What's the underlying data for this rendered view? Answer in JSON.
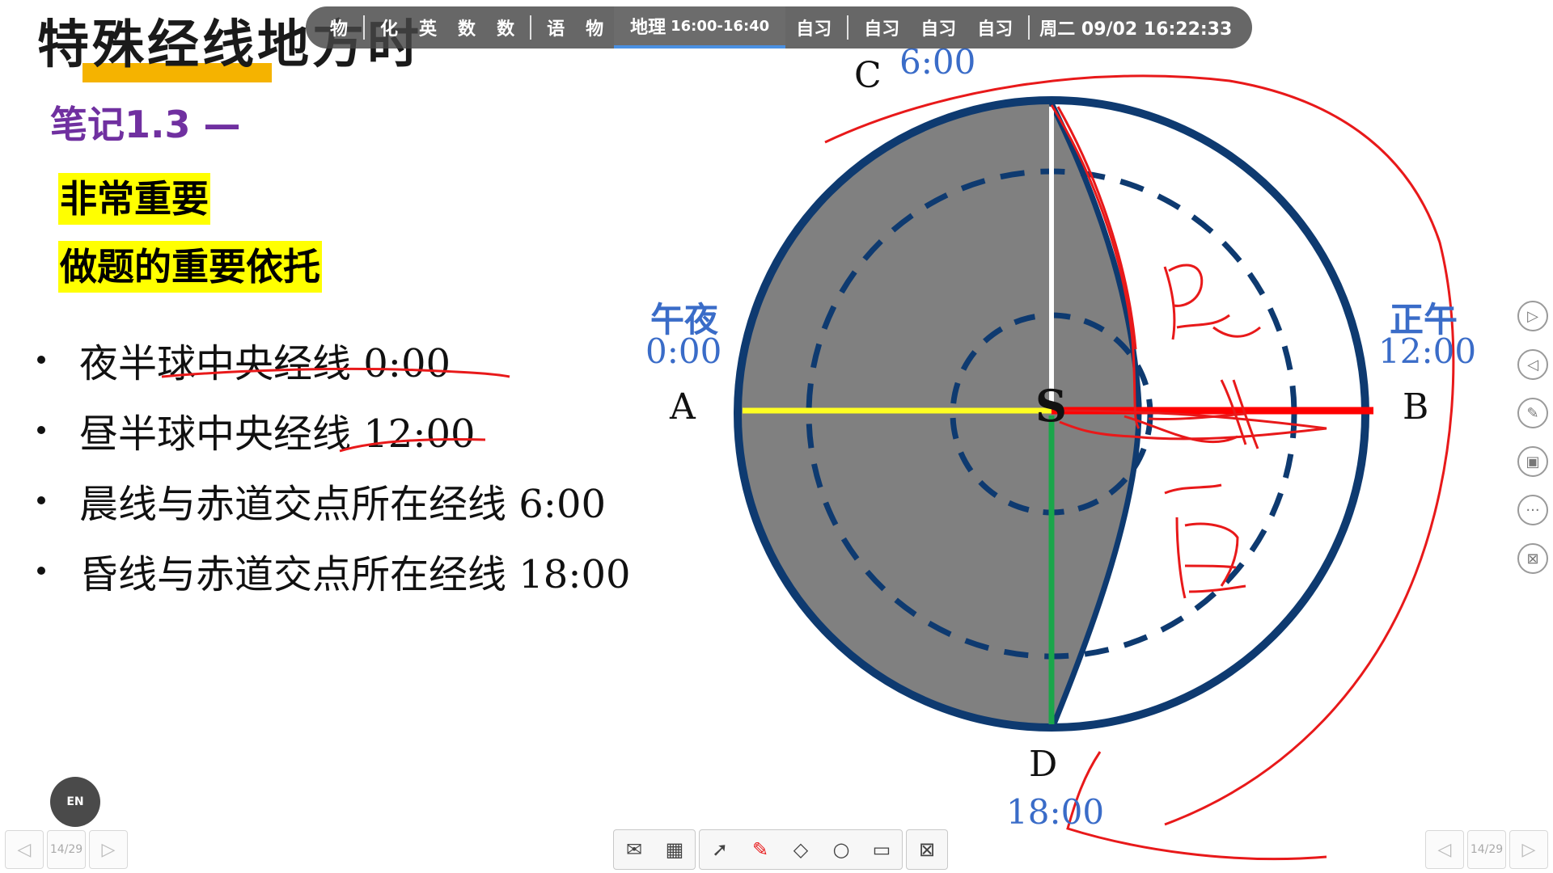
{
  "slide": {
    "title": "特殊经线地方时",
    "note_label": "笔记1.3 —",
    "highlights": [
      "非常重要",
      "做题的重要依托"
    ],
    "bullets": [
      "夜半球中央经线 0:00",
      "昼半球中央经线 12:00",
      "晨线与赤道交点所在经线 6:00",
      "昏线与赤道交点所在经线 18:00"
    ]
  },
  "toolbar": {
    "items_left": [
      "物",
      "化",
      "英",
      "数",
      "数",
      "语",
      "物"
    ],
    "active_subject": "地理",
    "active_time": "16:00-16:40",
    "items_right": [
      "自习",
      "自习",
      "自习",
      "自习"
    ],
    "clock_day_date": "周二 09/02",
    "clock_time": "16:22:33"
  },
  "diagram": {
    "label_c": "C",
    "label_c_time": "6:00",
    "label_a": "A",
    "label_a_name": "午夜",
    "label_a_time": "0:00",
    "label_b": "B",
    "label_b_name": "正午",
    "label_b_time": "12:00",
    "label_d": "D",
    "label_d_time": "18:00",
    "label_center": "S",
    "handwriting_top": "晨",
    "handwriting_bottom": "昏",
    "colors": {
      "circle_stroke": "#0e3a70",
      "night_fill": "#7f7f7f",
      "ink_red": "#e8191a",
      "midnight_line": "#ffff22",
      "noon_line": "#ff0000",
      "dusk_meridian": "#1aa64a",
      "label_blue": "#3a6cc8"
    }
  },
  "side_tools": [
    "play-next-icon",
    "play-prev-icon",
    "pen-settings-icon",
    "screen-icon",
    "more-icon",
    "close-screen-icon"
  ],
  "bottom_tools": {
    "buttons": [
      "mail-icon",
      "qr-icon",
      "pointer-icon",
      "pen-icon",
      "eraser-icon",
      "zoom-icon",
      "board-icon",
      "exit-presentation-icon"
    ]
  },
  "pager": {
    "page_label": "14/29"
  },
  "en_badge": "EN"
}
